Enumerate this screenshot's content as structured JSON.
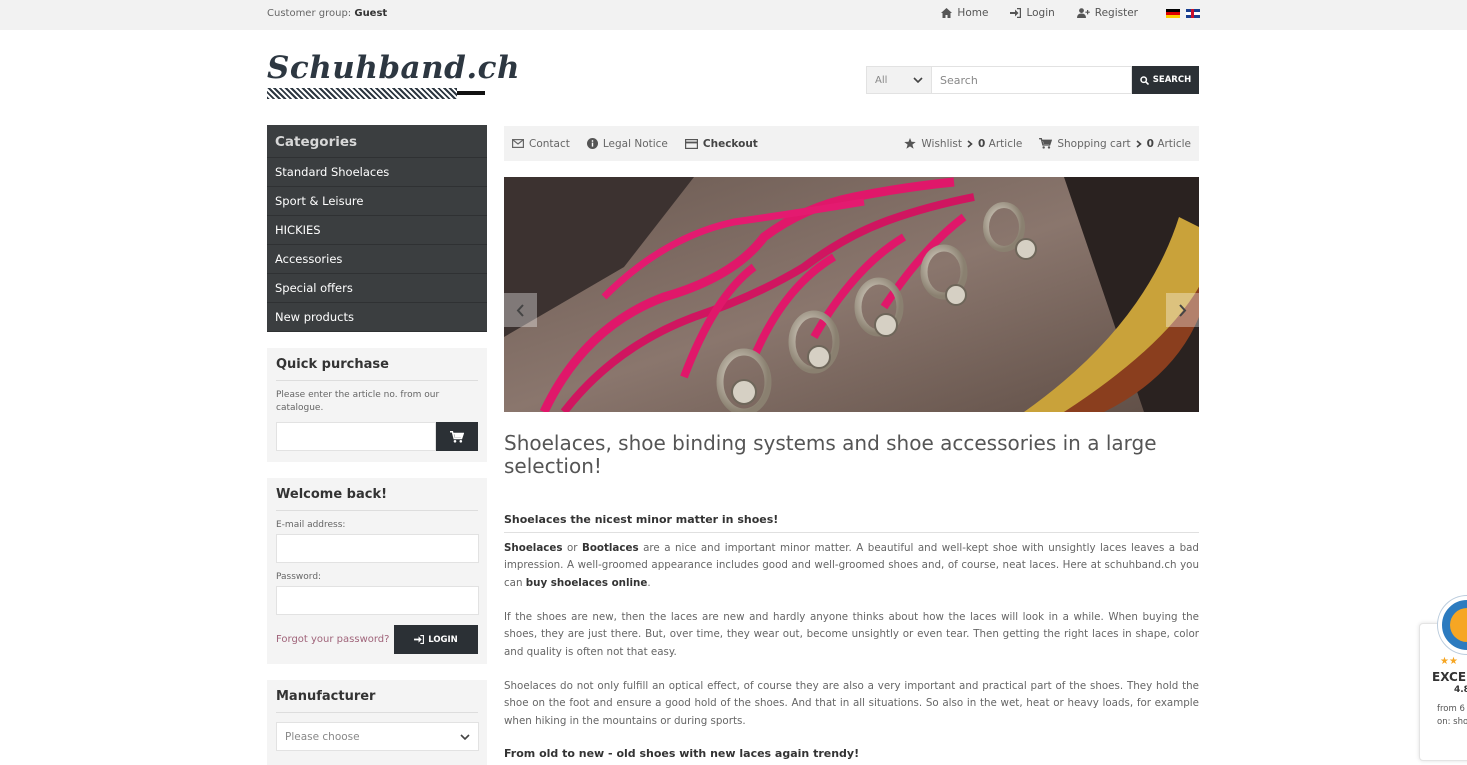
{
  "topbar": {
    "customer_group_label": "Customer group:",
    "customer_group_value": "Guest",
    "links": [
      "Home",
      "Login",
      "Register"
    ]
  },
  "logo": {
    "text": "Schuhband.ch"
  },
  "search": {
    "category": "All",
    "placeholder": "Search",
    "button": "SEARCH"
  },
  "categories": {
    "title": "Categories",
    "items": [
      "Standard Shoelaces",
      "Sport & Leisure",
      "HICKIES",
      "Accessories",
      "Special offers",
      "New products"
    ]
  },
  "quick_purchase": {
    "title": "Quick purchase",
    "hint": "Please enter the article no. from our catalogue."
  },
  "login": {
    "title": "Welcome back!",
    "email_label": "E-mail address:",
    "password_label": "Password:",
    "forgot": "Forgot your password?",
    "button": "LOGIN"
  },
  "manufacturer": {
    "title": "Manufacturer",
    "select_value": "Please choose"
  },
  "content_nav": {
    "contact": "Contact",
    "legal": "Legal Notice",
    "checkout": "Checkout",
    "wishlist": "Wishlist",
    "wishlist_count": "0",
    "cart": "Shopping cart",
    "cart_count": "0",
    "article": "Article"
  },
  "main": {
    "headline": "Shoelaces, shoe binding systems and shoe accessories in a large selection!",
    "sub1": "Shoelaces the nicest minor matter in shoes!",
    "p1": {
      "b1": "Shoelaces",
      "t1": " or ",
      "b2": "Bootlaces",
      "t2": " are a nice and important minor matter. A beautiful and well-kept shoe with unsightly laces leaves a bad impression. A well-groomed appearance includes good and well-groomed shoes and, of course, neat laces. Here at schuhband.ch you can ",
      "b3": "buy shoelaces online",
      "t3": "."
    },
    "p2": "If the shoes are new, then the laces are new and hardly anyone thinks about how the laces will look in a while. When buying the shoes, they are just there. But, over time, they wear out, become unsightly or even tear. Then getting the right laces in shape, color and quality is often not that easy.",
    "p3": "Shoelaces do not only fulfill an optical effect, of course they are also a very important and practical part of the shoes. They hold the shoe on the foot and ensure a good hold of the shoes. And that in all situations. So also in the wet, heat or heavy loads, for example when hiking in the mountains or during sports.",
    "sub2": "From old to new - old shoes with new laces again trendy!"
  },
  "trust_badge": {
    "rating_word": "EXCE",
    "score": "4.8",
    "from": "from 6",
    "on": "on: sho",
    "stars": "★★"
  },
  "colors": {
    "dark": "#2b3035",
    "category_bg": "#3b3e40",
    "lace_pink": "#e0176a"
  }
}
